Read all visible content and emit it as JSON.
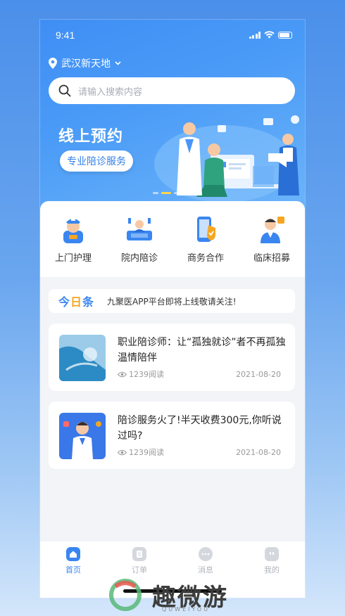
{
  "status_bar": {
    "time": "9:41"
  },
  "header": {
    "location": "武汉新天地",
    "search_placeholder": "请输入搜索内容"
  },
  "banner": {
    "title": "线上预约",
    "subtitle": "专业陪诊服务",
    "active_slide": 1,
    "slide_count": 3
  },
  "services": [
    {
      "label": "上门护理",
      "icon": "home-nurse-icon"
    },
    {
      "label": "院内陪诊",
      "icon": "hospital-bed-icon"
    },
    {
      "label": "商务合作",
      "icon": "business-phone-icon"
    },
    {
      "label": "临床招募",
      "icon": "clinical-recruit-icon"
    }
  ],
  "notice": {
    "brand_prefix": "今",
    "brand_highlight": "日",
    "brand_suffix": "条",
    "text": "九聚医APP平台即将上线敬请关注!"
  },
  "articles": [
    {
      "title": "职业陪诊师：让“孤独就诊”者不再孤独温情陪伴",
      "reads": "1239阅读",
      "date": "2021-08-20"
    },
    {
      "title": "陪诊服务火了!半天收费300元,你听说过吗?",
      "reads": "1239阅读",
      "date": "2021-08-20"
    }
  ],
  "tabbar": [
    {
      "label": "首页",
      "active": true
    },
    {
      "label": "订单",
      "active": false
    },
    {
      "label": "消息",
      "active": false
    },
    {
      "label": "我的",
      "active": false
    }
  ],
  "watermark": {
    "text": "趣微游",
    "sub": "QUWEIYOU"
  },
  "colors": {
    "primary": "#3a86f0",
    "accent": "#f5a623"
  }
}
